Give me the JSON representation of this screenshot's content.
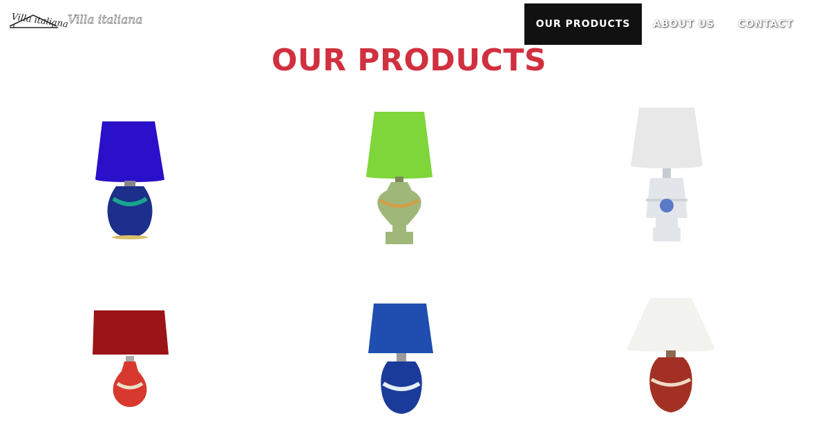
{
  "brand": {
    "name": "Villa italiana",
    "logo_text": "Villa italiana"
  },
  "nav": {
    "items": [
      {
        "label": "OUR PRODUCTS",
        "active": true
      },
      {
        "label": "ABOUT US",
        "active": false
      },
      {
        "label": "CONTACT",
        "active": false
      }
    ]
  },
  "main": {
    "title": "OUR PRODUCTS",
    "products": [
      {
        "shade_color": "#2a10c8",
        "base_color": "#1c2f8a",
        "accent": "#1aa58f",
        "base_shape": "round"
      },
      {
        "shade_color": "#7ed63a",
        "base_color": "#9fb87a",
        "accent": "#d0a04a",
        "base_shape": "urn"
      },
      {
        "shade_color": "#e8e8e8",
        "base_color": "#e2e6ea",
        "accent": "#5a7ac8",
        "base_shape": "urn-square"
      },
      {
        "shade_color": "#9a1418",
        "base_color": "#d8392e",
        "accent": "#e9e0c8",
        "base_shape": "vase"
      },
      {
        "shade_color": "#1f4eb0",
        "base_color": "#1b3b9a",
        "accent": "#e6eef8",
        "base_shape": "jar"
      },
      {
        "shade_color": "#f2f2ee",
        "base_color": "#a23024",
        "accent": "#efd9c4",
        "base_shape": "jar"
      }
    ]
  },
  "colors": {
    "title": "#d0303f",
    "nav_active_bg": "#111111"
  }
}
